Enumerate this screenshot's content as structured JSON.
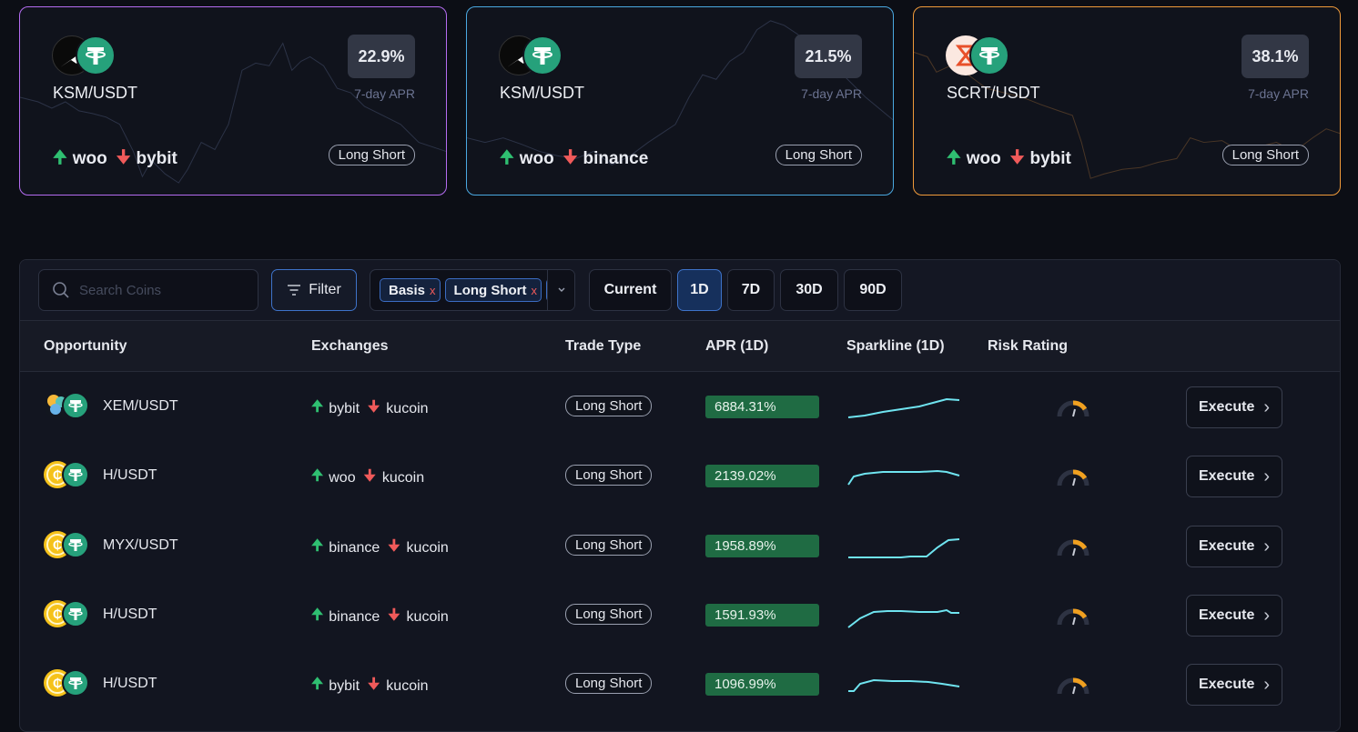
{
  "cards": [
    {
      "pair": "KSM/USDT",
      "apr": "22.9%",
      "apr_label": "7-day APR",
      "long_exchange": "woo",
      "short_exchange": "bybit",
      "trade_type": "Long Short",
      "border_color": "#b46cf0"
    },
    {
      "pair": "KSM/USDT",
      "apr": "21.5%",
      "apr_label": "7-day APR",
      "long_exchange": "woo",
      "short_exchange": "binance",
      "trade_type": "Long Short",
      "border_color": "#4aa8e0"
    },
    {
      "pair": "SCRT/USDT",
      "apr": "38.1%",
      "apr_label": "7-day APR",
      "long_exchange": "woo",
      "short_exchange": "bybit",
      "trade_type": "Long Short",
      "border_color": "#f09a3a"
    }
  ],
  "toolbar": {
    "search_placeholder": "Search Coins",
    "filter_label": "Filter",
    "tags": [
      "Basis",
      "Long Short"
    ],
    "periods": [
      "Current",
      "1D",
      "7D",
      "30D",
      "90D"
    ],
    "active_period": "1D"
  },
  "table": {
    "headers": {
      "opportunity": "Opportunity",
      "exchanges": "Exchanges",
      "trade_type": "Trade Type",
      "apr": "APR (1D)",
      "sparkline": "Sparkline (1D)",
      "risk": "Risk Rating"
    },
    "rows": [
      {
        "pair": "XEM/USDT",
        "long": "bybit",
        "short": "kucoin",
        "trade_type": "Long Short",
        "apr": "6884.31%",
        "action": "Execute"
      },
      {
        "pair": "H/USDT",
        "long": "woo",
        "short": "kucoin",
        "trade_type": "Long Short",
        "apr": "2139.02%",
        "action": "Execute"
      },
      {
        "pair": "MYX/USDT",
        "long": "binance",
        "short": "kucoin",
        "trade_type": "Long Short",
        "apr": "1958.89%",
        "action": "Execute"
      },
      {
        "pair": "H/USDT",
        "long": "binance",
        "short": "kucoin",
        "trade_type": "Long Short",
        "apr": "1591.93%",
        "action": "Execute"
      },
      {
        "pair": "H/USDT",
        "long": "bybit",
        "short": "kucoin",
        "trade_type": "Long Short",
        "apr": "1096.99%",
        "action": "Execute"
      }
    ]
  },
  "colors": {
    "accent": "#3e73c9",
    "up_arrow": "#2fbf71",
    "down_arrow": "#f05a5a",
    "apr_bg": "#1f6b43",
    "sparkline": "#6fe4f0",
    "gauge_warn": "#f0a020"
  },
  "icons": {
    "up": "arrow-up-icon",
    "down": "arrow-down-icon",
    "search": "search-icon",
    "filter": "filter-icon",
    "chevron": "chevron-right-icon",
    "dropdown": "chevron-down-icon"
  }
}
